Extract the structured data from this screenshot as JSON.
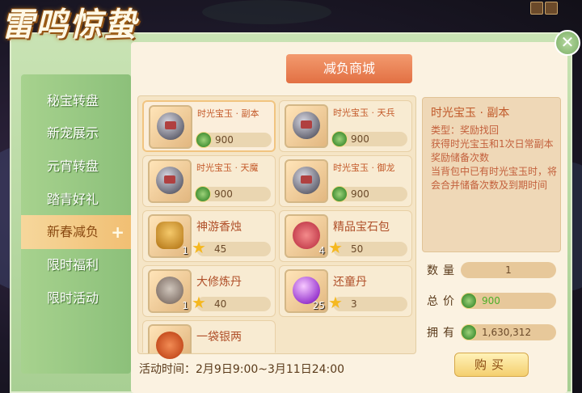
{
  "app": {
    "title": "雷鸣惊蛰"
  },
  "window": {
    "close_symbol": "✕"
  },
  "sidebar": {
    "items": [
      {
        "label": "秘宝转盘",
        "active": false
      },
      {
        "label": "新宠展示",
        "active": false
      },
      {
        "label": "元宵转盘",
        "active": false
      },
      {
        "label": "踏青好礼",
        "active": false
      },
      {
        "label": "新春减负",
        "active": true,
        "plus": "+"
      },
      {
        "label": "限时福利",
        "active": false
      },
      {
        "label": "限时活动",
        "active": false
      }
    ]
  },
  "shop": {
    "title": "减负商城"
  },
  "items": [
    {
      "name": "时光宝玉 · 副本",
      "icon": "time-jade-icon",
      "price": "900",
      "currency": "coin",
      "selected": true
    },
    {
      "name": "时光宝玉 · 天兵",
      "icon": "time-jade-icon",
      "price": "900",
      "currency": "coin"
    },
    {
      "name": "时光宝玉 · 天魔",
      "icon": "time-jade-icon",
      "price": "900",
      "currency": "coin"
    },
    {
      "name": "时光宝玉 · 御龙",
      "icon": "time-jade-icon",
      "price": "900",
      "currency": "coin"
    },
    {
      "name": "神游香烛",
      "icon": "incense-cup-icon",
      "count": "1",
      "price": "45",
      "currency": "star"
    },
    {
      "name": "精品宝石包",
      "icon": "gem-bag-icon",
      "count": "4",
      "price": "50",
      "currency": "star"
    },
    {
      "name": "大修炼丹",
      "icon": "pill-pot-icon",
      "count": "1",
      "price": "40",
      "currency": "star"
    },
    {
      "name": "还童丹",
      "icon": "purple-pearl-icon",
      "count": "25",
      "price": "3",
      "currency": "star"
    },
    {
      "name": "一袋银两",
      "icon": "money-bag-icon"
    }
  ],
  "detail": {
    "name": "时光宝玉 · 副本",
    "lines": [
      "类型：奖励找回",
      "获得时光宝玉和1次日常副本奖励储备次数",
      "当背包中已有时光宝玉时，将会合并储备次数及到期时间"
    ]
  },
  "purchase": {
    "quantity_label": "数量",
    "quantity": "1",
    "total_label": "总价",
    "total": "900",
    "owned_label": "拥有",
    "owned": "1,630,312",
    "buy_label": "购买"
  },
  "activity_time": "活动时间：2月9日9:00~3月11日24:00",
  "colors": {
    "accent": "#e27043",
    "panel_green": "#a8cf93",
    "content_bg": "#fbf2e1"
  }
}
